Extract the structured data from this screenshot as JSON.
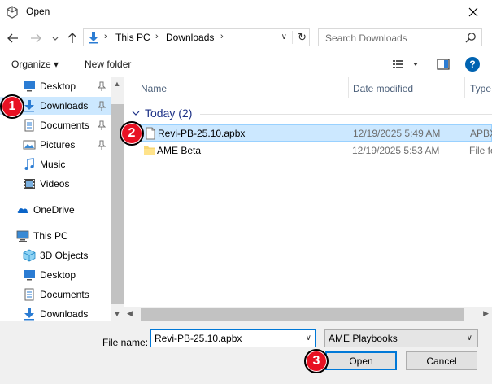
{
  "window": {
    "title": "Open"
  },
  "address": {
    "crumbs": [
      "This PC",
      "Downloads"
    ]
  },
  "search": {
    "placeholder": "Search Downloads"
  },
  "toolbar": {
    "organize": "Organize ▾",
    "new_folder": "New folder"
  },
  "nav": {
    "items": [
      {
        "label": "Desktop",
        "icon": "desktop-icon",
        "pinned": true
      },
      {
        "label": "Downloads",
        "icon": "downloads-icon",
        "pinned": true,
        "selected": true
      },
      {
        "label": "Documents",
        "icon": "documents-icon",
        "pinned": true
      },
      {
        "label": "Pictures",
        "icon": "pictures-icon",
        "pinned": true
      },
      {
        "label": "Music",
        "icon": "music-icon"
      },
      {
        "label": "Videos",
        "icon": "videos-icon"
      },
      {
        "label": "OneDrive",
        "icon": "onedrive-icon"
      },
      {
        "label": "This PC",
        "icon": "this-pc-icon"
      },
      {
        "label": "3D Objects",
        "icon": "3d-objects-icon"
      },
      {
        "label": "Desktop",
        "icon": "desktop-icon"
      },
      {
        "label": "Documents",
        "icon": "documents-icon"
      },
      {
        "label": "Downloads",
        "icon": "downloads-icon"
      }
    ]
  },
  "columns": {
    "name": "Name",
    "date": "Date modified",
    "type": "Type"
  },
  "group": {
    "label": "Today (2)"
  },
  "files": [
    {
      "name": "Revi-PB-25.10.apbx",
      "date": "12/19/2025 5:49 AM",
      "type": "APBX",
      "icon": "file-icon",
      "selected": true
    },
    {
      "name": "AME Beta",
      "date": "12/19/2025 5:53 AM",
      "type": "File fo",
      "icon": "folder-icon"
    }
  ],
  "bottom": {
    "file_name_label": "File name:",
    "file_name_value": "Revi-PB-25.10.apbx",
    "file_type_value": "AME Playbooks",
    "open_label": "Open",
    "cancel_label": "Cancel"
  },
  "markers": [
    "1",
    "2",
    "3"
  ],
  "colors": {
    "accent": "#0078d7",
    "selection": "#cce8ff",
    "marker": "#e81123"
  }
}
